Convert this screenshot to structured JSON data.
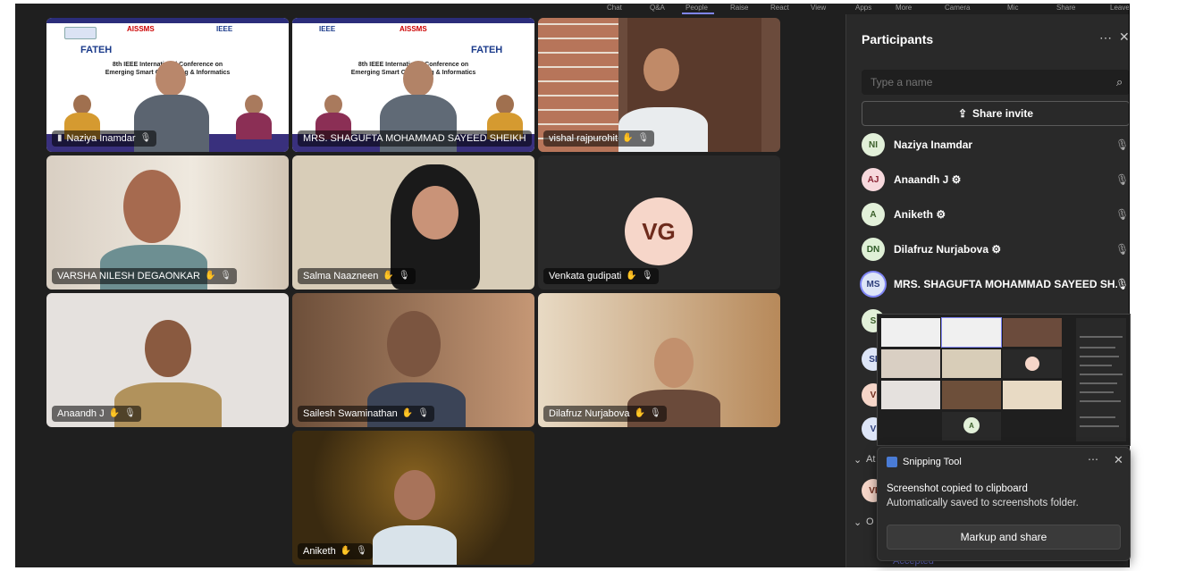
{
  "topbar": {
    "tabs": [
      "Chat",
      "Q&A",
      "People",
      "Raise",
      "React",
      "View",
      "Apps",
      "More",
      "Camera",
      "Mic",
      "Share",
      "Leave"
    ]
  },
  "tiles": [
    {
      "name": "Naziya Inamdar"
    },
    {
      "name": "MRS. SHAGUFTA MOHAMMAD SAYEED SHEIKH"
    },
    {
      "name": "vishal rajpurohit"
    },
    {
      "name": "VARSHA NILESH DEGAONKAR"
    },
    {
      "name": "Salma Naazneen"
    },
    {
      "name": "Venkata gudipati",
      "initials": "VG"
    },
    {
      "name": "Anaandh J"
    },
    {
      "name": "Sailesh Swaminathan"
    },
    {
      "name": "Dilafruz Nurjabova"
    },
    {
      "name": "Aniketh"
    }
  ],
  "slide": {
    "text1": "IEEE",
    "text2": "AISSMS",
    "text3": "FATEH",
    "title": "8th IEEE International Conference on Emerging Smart Computing & Informatics"
  },
  "participants": {
    "title": "Participants",
    "search_placeholder": "Type a name",
    "invite_label": "Share invite",
    "list": [
      {
        "initials": "NI",
        "name": "Naziya Inamdar",
        "color": "#e2f0d9",
        "text": "#3b5f2a"
      },
      {
        "initials": "AJ",
        "name": "Anaandh J ⚙",
        "color": "#f7d9dd",
        "text": "#8a2434"
      },
      {
        "initials": "A",
        "name": "Aniketh ⚙",
        "color": "#e2f0d9",
        "text": "#3b5f2a"
      },
      {
        "initials": "DN",
        "name": "Dilafruz Nurjabova ⚙",
        "color": "#dff0d6",
        "text": "#2e5a26"
      },
      {
        "initials": "MS",
        "name": "MRS. SHAGUFTA MOHAMMAD SAYEED SH...",
        "color": "#dde5f7",
        "text": "#2d3e7a"
      }
    ],
    "partial_rows": [
      "S",
      "SI",
      "V",
      "V",
      "VI"
    ],
    "section_labels": [
      "At",
      "O"
    ],
    "accepted_label": "Accepted"
  },
  "toast": {
    "app": "Snipping Tool",
    "line1": "Screenshot copied to clipboard",
    "line2": "Automatically saved to screenshots folder.",
    "button": "Markup and share",
    "mini_avatar": "A"
  }
}
